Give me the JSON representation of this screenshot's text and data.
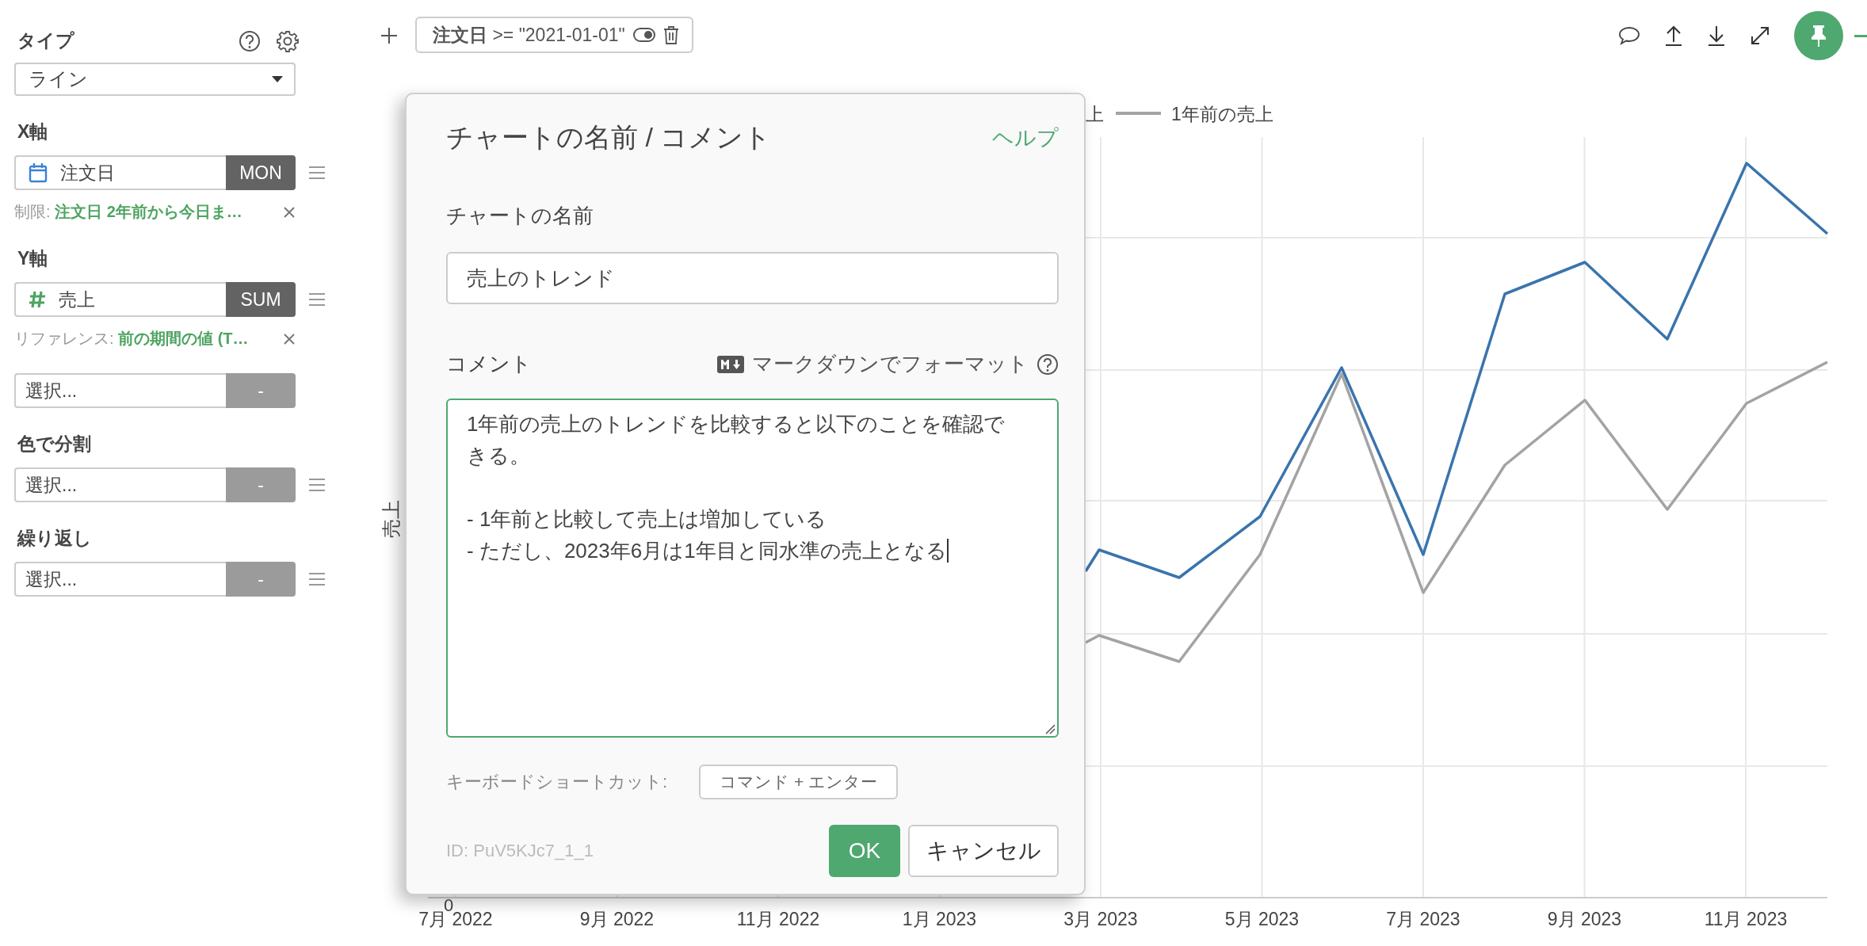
{
  "sidebar": {
    "type_label": "タイプ",
    "type_value": "ライン",
    "rows": [
      {
        "kind": "date",
        "label": "X軸",
        "value": "注文日",
        "aggregate": "MON",
        "handle": true,
        "note_label": "制限:",
        "note_value": "注文日 2年前から今日ま…"
      },
      {
        "kind": "number",
        "label": "Y軸",
        "value": "売上",
        "aggregate": "SUM",
        "handle": true,
        "note_label": "リファレンス:",
        "note_value": "前の期間の値 (T…"
      },
      {
        "kind": "empty",
        "value": "選択...",
        "aggregate": "-",
        "handle": false
      },
      {
        "kind": "empty",
        "label": "色で分割",
        "value": "選択...",
        "aggregate": "-",
        "handle": true
      },
      {
        "kind": "empty",
        "label": "繰り返し",
        "value": "選択...",
        "aggregate": "-",
        "handle": true
      }
    ]
  },
  "toolbar": {
    "filter": {
      "field": "注文日",
      "condition": ">= \"2021-01-01\"",
      "enabled": true
    },
    "pinned": true
  },
  "chart": {
    "y_label": "売上",
    "y_tick": "0",
    "series": [
      {
        "name": "上",
        "color": "#3a74ad"
      },
      {
        "name": "1年前の売上",
        "color": "#a3a3a3"
      }
    ],
    "x_ticks": [
      "7月 2022",
      "9月 2022",
      "11月 2022",
      "1月 2023",
      "3月 2023",
      "5月 2023",
      "7月 2023",
      "9月 2023",
      "11月 2023"
    ]
  },
  "dialog": {
    "title": "チャートの名前 / コメント",
    "help": "ヘルプ",
    "name_label": "チャートの名前",
    "name_value": "売上のトレンド",
    "comment_label": "コメント",
    "markdown_label": "マークダウンでフォーマット",
    "comment": "1年前の売上のトレンドを比較すると以下のことを確認できる。\n\n- 1年前と比較して売上は増加している\n- ただし、2023年6月は1年目と同水準の売上となる",
    "shortcut_label": "キーボードショートカット:",
    "shortcut": "コマンド + エンター",
    "id": "ID: PuV5KJc7_1_1",
    "ok": "OK",
    "cancel": "キャンセル"
  }
}
